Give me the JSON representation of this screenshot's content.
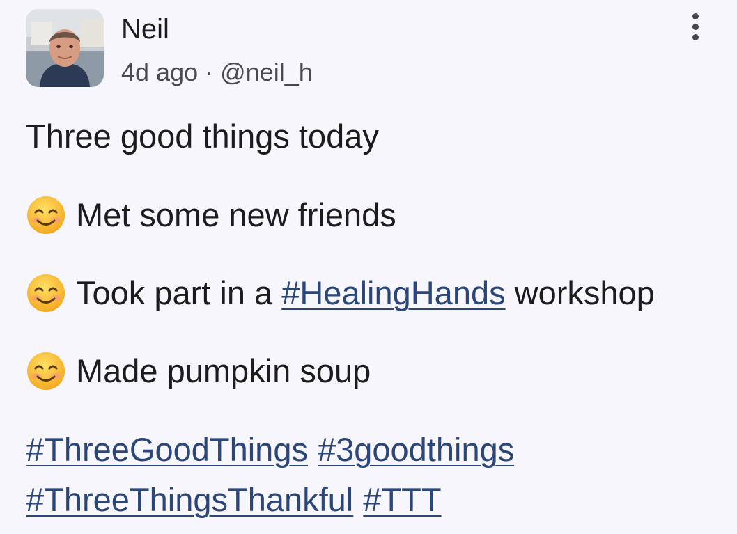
{
  "author": {
    "name": "Neil",
    "time": "4d ago",
    "separator": "·",
    "handle": "@neil_h"
  },
  "post": {
    "intro": "Three good things today",
    "items": [
      {
        "emoji": "smiling-face-emoji",
        "before": "Met some new friends",
        "tag": "",
        "after": ""
      },
      {
        "emoji": "smiling-face-emoji",
        "before": "Took part in a ",
        "tag": "#HealingHands",
        "after": " workshop"
      },
      {
        "emoji": "smiling-face-emoji",
        "before": "Made pumpkin soup",
        "tag": "",
        "after": ""
      }
    ],
    "hashtags_line1": [
      "#ThreeGoodThings",
      "#3goodthings"
    ],
    "hashtags_line2": [
      "#ThreeThingsThankful",
      "#TTT"
    ]
  },
  "icons": {
    "more": "more-vert-icon",
    "emoji": "smiling-face-emoji"
  },
  "colors": {
    "background": "#f7f6fc",
    "text": "#1d1b20",
    "link": "#2b4678",
    "secondary": "#4a4850"
  }
}
